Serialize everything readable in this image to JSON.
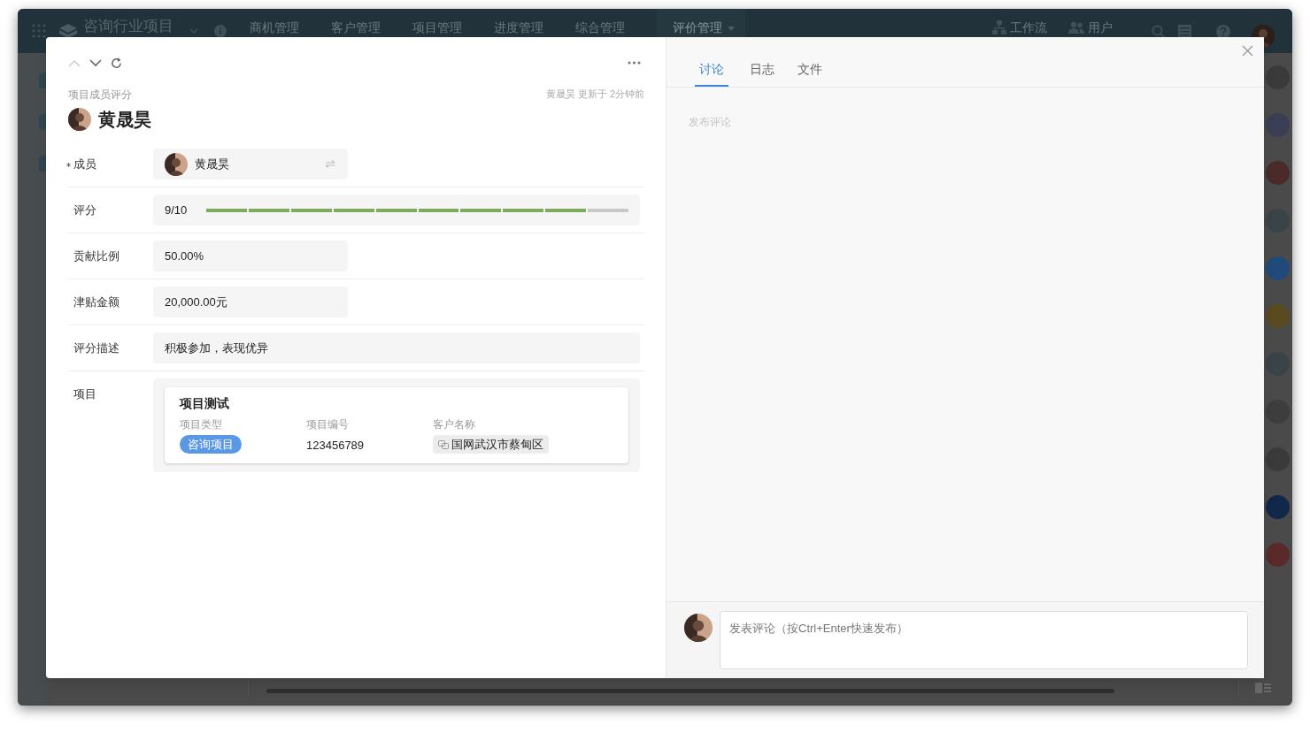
{
  "app_bar": {
    "title": "咨询行业项目",
    "nav": [
      {
        "label": "商机管理",
        "selected": false
      },
      {
        "label": "客户管理",
        "selected": false
      },
      {
        "label": "项目管理",
        "selected": false
      },
      {
        "label": "进度管理",
        "selected": false
      },
      {
        "label": "综合管理",
        "selected": false
      },
      {
        "label": "评价管理",
        "selected": true
      }
    ],
    "links": [
      {
        "kind": "workflow",
        "label": "工作流"
      },
      {
        "kind": "users",
        "label": "用户"
      }
    ]
  },
  "record": {
    "type_label": "项目成员评分",
    "updated": "黄晟昊 更新于 2分钟前",
    "title": "黄晟昊",
    "fields": [
      {
        "kind": "member",
        "label": "成员",
        "required": true,
        "value": "黄晟昊"
      },
      {
        "kind": "rating",
        "label": "评分",
        "required": false,
        "value": "9/10",
        "level": 0.9
      },
      {
        "kind": "text",
        "label": "贡献比例",
        "required": false,
        "value": "50.00%",
        "wide": false
      },
      {
        "kind": "text",
        "label": "津贴金额",
        "required": false,
        "value": "20,000.00元",
        "wide": false
      },
      {
        "kind": "text",
        "label": "评分描述",
        "required": false,
        "value": "积极参加，表现优异",
        "wide": true
      },
      {
        "kind": "project",
        "label": "项目",
        "required": false,
        "name": "项目测试",
        "columns": [
          {
            "kind": "tag",
            "label": "项目类型",
            "value": "咨询项目"
          },
          {
            "kind": "text",
            "label": "项目编号",
            "value": "123456789"
          },
          {
            "kind": "link",
            "label": "客户名称",
            "value": "国网武汉市蔡甸区"
          }
        ]
      }
    ]
  },
  "discussion": {
    "tabs": [
      {
        "label": "讨论",
        "selected": true
      },
      {
        "label": "日志",
        "selected": false
      },
      {
        "label": "文件",
        "selected": false
      }
    ],
    "empty_label": "发布评论",
    "input": {
      "placeholder": "发表评论（按Ctrl+Enter快速发布）"
    }
  }
}
